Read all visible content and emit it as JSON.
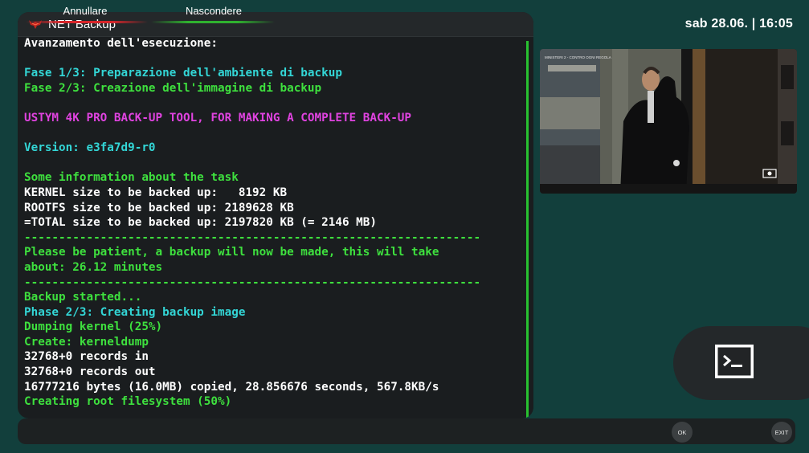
{
  "window": {
    "title": "NET Backup",
    "logo_icon": "red-crab-logo-icon"
  },
  "clock": "sab 28.06. | 16:05",
  "log_lines": [
    {
      "text": "Avanzamento dell'esecuzione:",
      "color": "#ffffff"
    },
    {
      "text": "",
      "color": "#ffffff"
    },
    {
      "text": "Fase 1/3: Preparazione dell'ambiente di backup",
      "color": "#33d6d6"
    },
    {
      "text": "Fase 2/3: Creazione dell'immagine di backup",
      "color": "#3ee03e"
    },
    {
      "text": "",
      "color": "#ffffff"
    },
    {
      "text": "USTYM 4K PRO BACK-UP TOOL, FOR MAKING A COMPLETE BACK-UP",
      "color": "#e043e0"
    },
    {
      "text": "",
      "color": "#ffffff"
    },
    {
      "text": "Version: e3fa7d9-r0",
      "color": "#33d6d6"
    },
    {
      "text": "",
      "color": "#ffffff"
    },
    {
      "text": "Some information about the task",
      "color": "#3ee03e"
    },
    {
      "text": "KERNEL size to be backed up:   8192 KB",
      "color": "#ffffff"
    },
    {
      "text": "ROOTFS size to be backed up: 2189628 KB",
      "color": "#ffffff"
    },
    {
      "text": "=TOTAL size to be backed up: 2197820 KB (= 2146 MB)",
      "color": "#ffffff"
    },
    {
      "text": "------------------------------------------------------------------",
      "color": "#3ee03e"
    },
    {
      "text": "Please be patient, a backup will now be made, this will take",
      "color": "#3ee03e"
    },
    {
      "text": "about: 26.12 minutes",
      "color": "#3ee03e"
    },
    {
      "text": "------------------------------------------------------------------",
      "color": "#3ee03e"
    },
    {
      "text": "Backup started...",
      "color": "#3ee03e"
    },
    {
      "text": "Phase 2/3: Creating backup image",
      "color": "#33d6d6"
    },
    {
      "text": "Dumping kernel (25%)",
      "color": "#3ee03e"
    },
    {
      "text": "Create: kerneldump",
      "color": "#3ee03e"
    },
    {
      "text": "32768+0 records in",
      "color": "#ffffff"
    },
    {
      "text": "32768+0 records out",
      "color": "#ffffff"
    },
    {
      "text": "16777216 bytes (16.0MB) copied, 28.856676 seconds, 567.8KB/s",
      "color": "#ffffff"
    },
    {
      "text": "Creating root filesystem (50%)",
      "color": "#3ee03e"
    }
  ],
  "video_preview": {
    "overlay_text": "MINISTERI 2 - CONTRO OGNI REGOLA",
    "icon": "channel-logo-icon"
  },
  "terminal_icon": "terminal-icon",
  "buttons": {
    "red": {
      "label": "Annullare",
      "color": "#d8252a"
    },
    "green": {
      "label": "Nascondere",
      "color": "#2fb12f"
    },
    "ok": "OK",
    "exit": "EXIT"
  }
}
